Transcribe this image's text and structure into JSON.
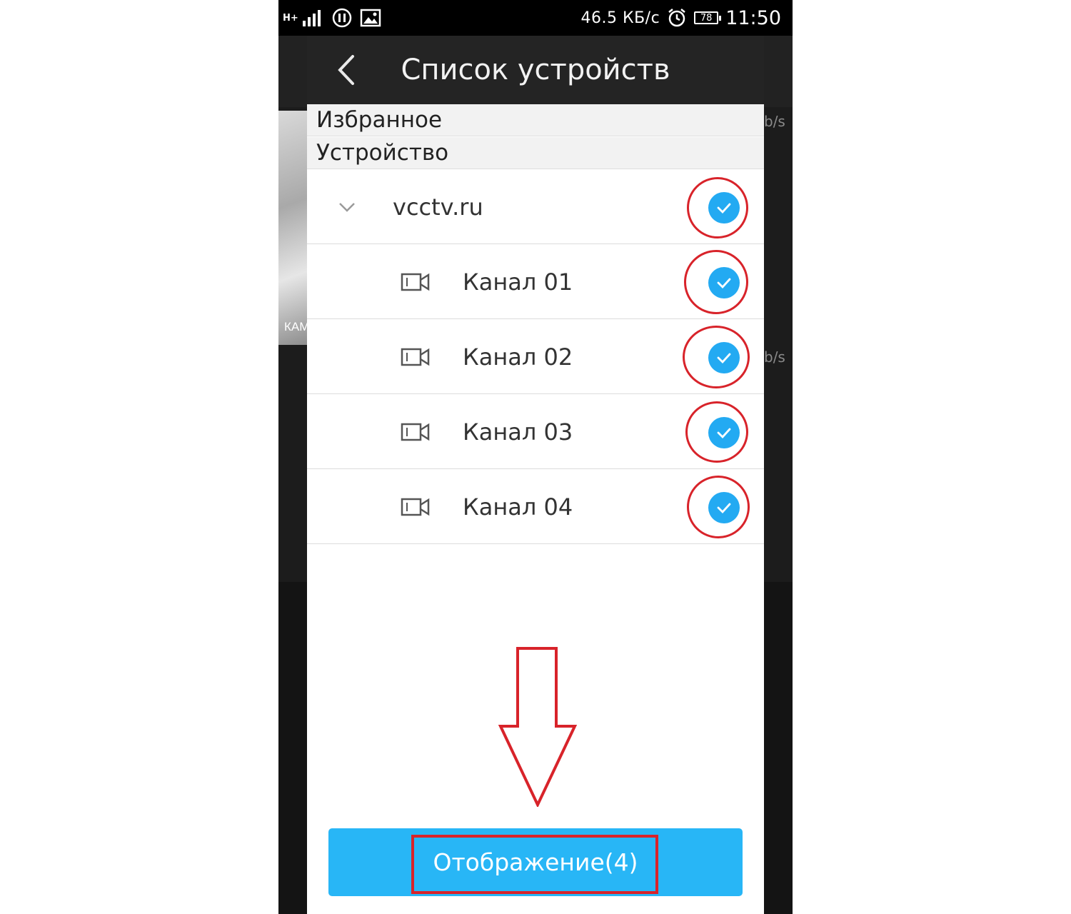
{
  "status_bar": {
    "network": "H+",
    "net_speed": "46.5 КБ/с",
    "battery": "78",
    "time": "11:50",
    "icons": [
      "signal-icon",
      "pause-icon",
      "image-icon",
      "alarm-icon",
      "battery-icon"
    ]
  },
  "background": {
    "video_label": "КАМ",
    "rate_1": "b/s",
    "rate_2": "b/s"
  },
  "header": {
    "title": "Список устройств",
    "back_icon": "chevron-left-icon"
  },
  "sections": {
    "favorites": "Избранное",
    "device": "Устройство"
  },
  "device": {
    "name": "vcctv.ru",
    "expanded": true,
    "checked": true
  },
  "channels": [
    {
      "label": "Канал 01",
      "checked": true
    },
    {
      "label": "Канал 02",
      "checked": true
    },
    {
      "label": "Канал 03",
      "checked": true
    },
    {
      "label": "Канал 04",
      "checked": true
    }
  ],
  "action": {
    "display_label": "Отображение(4)"
  },
  "colors": {
    "accent": "#28b6f6",
    "check": "#23aaf2",
    "annotation": "#d8232a",
    "header": "#242424"
  }
}
